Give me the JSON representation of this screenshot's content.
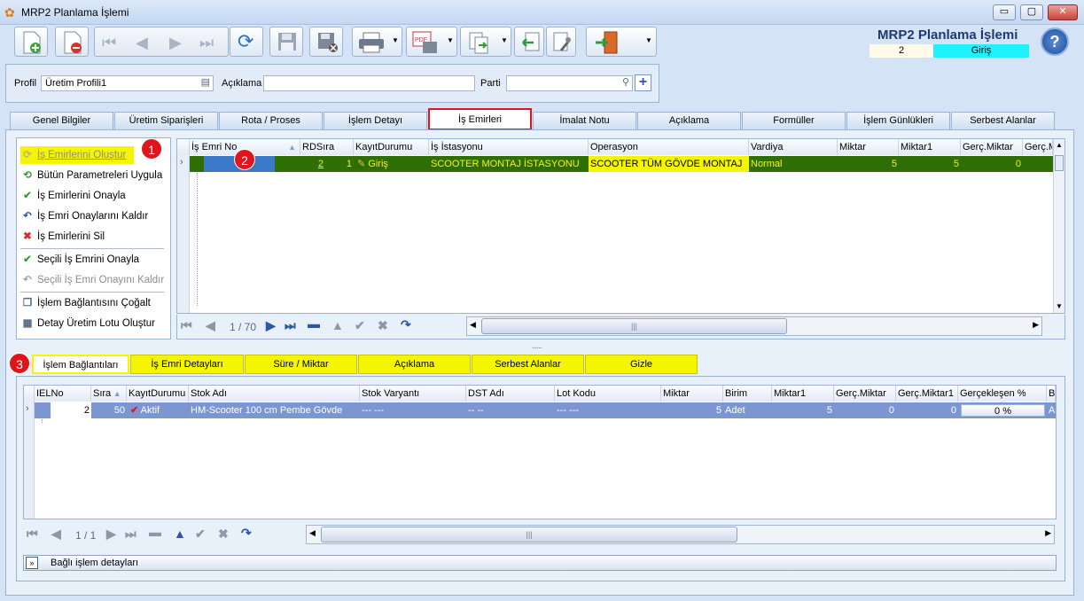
{
  "window": {
    "title": "MRP2 Planlama İşlemi",
    "min": "▭",
    "max": "▢",
    "close": "✕"
  },
  "header": {
    "title": "MRP2 Planlama İşlemi",
    "number": "2",
    "status": "Giriş",
    "help": "?"
  },
  "profile": {
    "profil_label": "Profil",
    "profil_value": "Üretim Profili1",
    "aciklama_label": "Açıklama",
    "aciklama_value": "",
    "parti_label": "Parti",
    "parti_value": ""
  },
  "tabs": [
    "Genel Bilgiler",
    "Üretim Siparişleri",
    "Rota / Proses",
    "İşlem Detayı",
    "İş Emirleri",
    "İmalat Notu",
    "Açıklama",
    "Formüller",
    "İşlem Günlükleri",
    "Serbest Alanlar"
  ],
  "actions": [
    "İş Emirlerini Oluştur",
    "Bütün Parametreleri Uygula",
    "İş Emirlerini Onayla",
    "İş Emri Onaylarını Kaldır",
    "İş Emirlerini Sil",
    "Seçili İş Emrini Onayla",
    "Seçili İş Emri Onayını Kaldır",
    "İşlem Bağlantısını Çoğalt",
    "Detay Üretim Lotu Oluştur"
  ],
  "markers": {
    "m1": "1",
    "m2": "2",
    "m3": "3"
  },
  "top_grid": {
    "columns": [
      "İş Emri No",
      "RDSıra",
      "KayıtDurumu",
      "İş İstasyonu",
      "Operasyon",
      "Vardiya",
      "Miktar",
      "Miktar1",
      "Gerç.Miktar",
      "Gerç.M"
    ],
    "row": {
      "is_emri_no": "",
      "rdsira": "2",
      "rd2": "1",
      "kayit": "Giriş",
      "istasyon": "SCOOTER MONTAJ İSTASYONU",
      "operasyon": "SCOOTER TÜM GÖVDE MONTAJ",
      "vardiya": "Normal",
      "miktar": "5",
      "miktar1": "5",
      "gerc": "0"
    },
    "pager": "1 / 70"
  },
  "bottom_tabs": [
    "İşlem Bağlantıları",
    "İş Emri Detayları",
    "Süre / Miktar",
    "Açıklama",
    "Serbest Alanlar",
    "Gizle"
  ],
  "bottom_grid": {
    "columns": [
      "IELNo",
      "Sıra",
      "KayıtDurumu",
      "Stok Adı",
      "Stok Varyantı",
      "DST Adı",
      "Lot Kodu",
      "Miktar",
      "Birim",
      "Miktar1",
      "Gerç.Miktar",
      "Gerç.Miktar1",
      "Gerçekleşen %",
      "Bi"
    ],
    "row": {
      "ielno": "2",
      "sira": "50",
      "kayit": "Aktif",
      "stok": "HM-Scooter 100 cm Pembe Gövde",
      "varyant": "--- ---",
      "dst": "-- --",
      "lot": "--- ---",
      "miktar": "5",
      "birim": "Adet",
      "miktar1": "5",
      "gerc": "0",
      "gerc1": "0",
      "yuzde": "0 %",
      "bi": "A"
    },
    "pager": "1 / 1"
  },
  "footer": {
    "label": "Bağlı işlem detayları"
  },
  "splitter": "......"
}
